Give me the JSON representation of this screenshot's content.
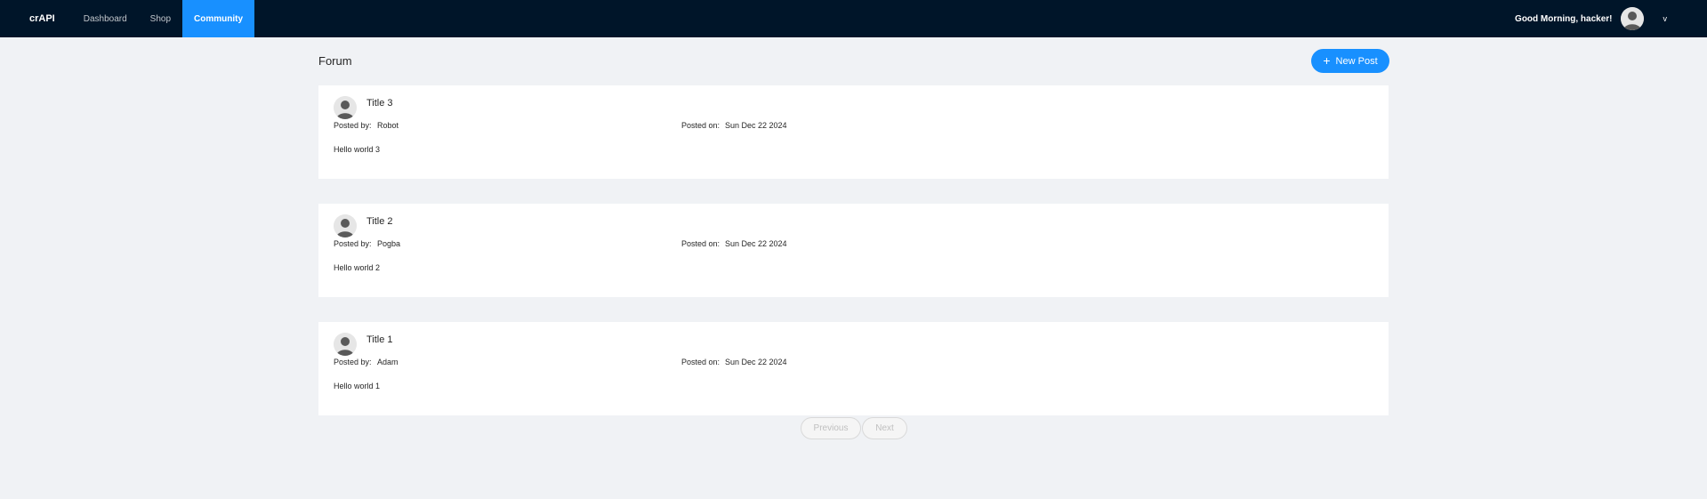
{
  "nav": {
    "brand": "crAPI",
    "items": [
      {
        "label": "Dashboard"
      },
      {
        "label": "Shop"
      },
      {
        "label": "Community"
      }
    ],
    "active": "Community",
    "greeting": "Good Morning, hacker!",
    "caret": "v"
  },
  "forum": {
    "title": "Forum",
    "new_post_label": "New Post",
    "new_post_icon": "+"
  },
  "posts": [
    {
      "title": "Title 3",
      "posted_by_label": "Posted by:",
      "author": "Robot",
      "posted_on_label": "Posted on:",
      "date": "Sun Dec 22 2024",
      "body": "Hello world 3"
    },
    {
      "title": "Title 2",
      "posted_by_label": "Posted by:",
      "author": "Pogba",
      "posted_on_label": "Posted on:",
      "date": "Sun Dec 22 2024",
      "body": "Hello world 2"
    },
    {
      "title": "Title 1",
      "posted_by_label": "Posted by:",
      "author": "Adam",
      "posted_on_label": "Posted on:",
      "date": "Sun Dec 22 2024",
      "body": "Hello world 1"
    }
  ],
  "pagination": {
    "previous_label": "Previous",
    "next_label": "Next"
  },
  "colors": {
    "topbar_bg": "#001529",
    "accent": "#1890ff",
    "page_bg": "#f0f2f5"
  }
}
